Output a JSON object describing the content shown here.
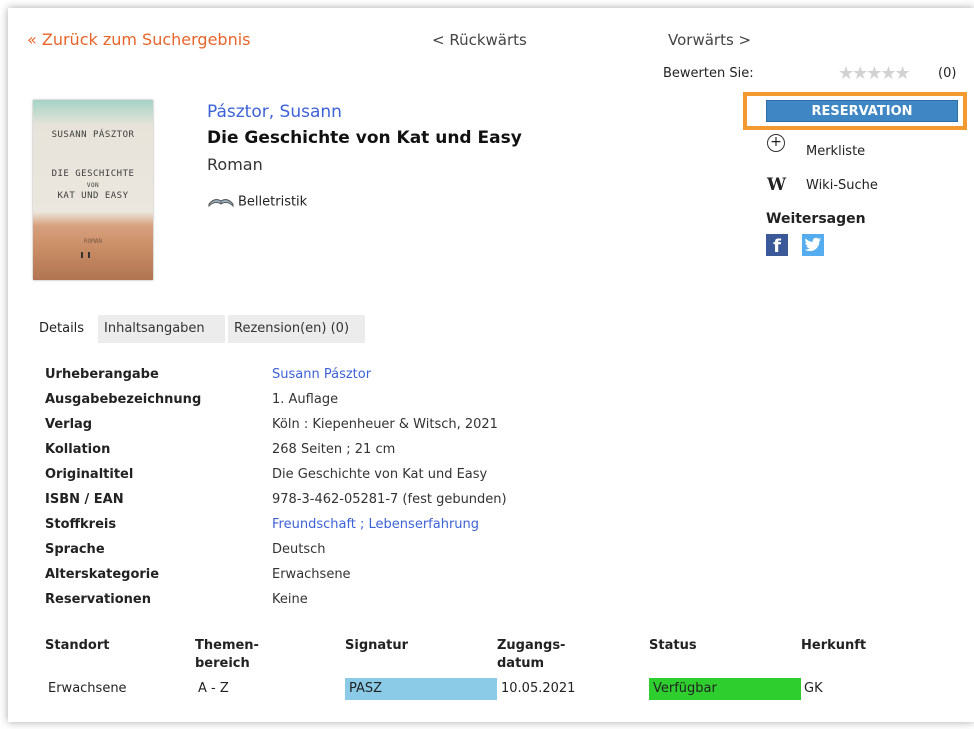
{
  "nav": {
    "back_label": "« Zurück zum Suchergebnis",
    "prev_label": "< Rückwärts",
    "next_label": "Vorwärts >"
  },
  "rating": {
    "label": "Bewerten Sie:",
    "stars": "★★★★★",
    "count": "(0)",
    "value": 0
  },
  "cover": {
    "author": "SUSANN PÁSZTOR",
    "title_line1": "DIE GESCHICHTE",
    "title_line2": "VON",
    "title_line3": "KAT UND EASY",
    "genre": "ROMAN"
  },
  "book": {
    "author": "Pásztor, Susann",
    "title": "Die Geschichte von Kat und Easy",
    "subtitle": "Roman",
    "genre": "Belletristik"
  },
  "actions": {
    "reserve_label": "RESERVATION",
    "merkliste_label": "Merkliste",
    "wiki_icon": "W",
    "wiki_label": "Wiki-Suche",
    "share_label": "Weitersagen",
    "facebook_icon": "f"
  },
  "tabs": [
    "Details",
    "Inhaltsangaben",
    "Rezension(en) (0)"
  ],
  "details": [
    {
      "label": "Urheberangabe",
      "value": "Susann Pásztor"
    },
    {
      "label": "Ausgabebezeichnung",
      "value": "1. Auflage"
    },
    {
      "label": "Verlag",
      "value": "Köln : Kiepenheuer & Witsch, 2021"
    },
    {
      "label": "Kollation",
      "value": "268 Seiten ; 21 cm"
    },
    {
      "label": "Originaltitel",
      "value": "Die Geschichte von Kat und Easy"
    },
    {
      "label": "ISBN / EAN",
      "value": "978-3-462-05281-7 (fest gebunden)"
    },
    {
      "label": "Stoffkreis",
      "value": "Freundschaft ; Lebenserfahrung",
      "link1": "Freundschaft",
      "sep": " ; ",
      "link2": "Lebenserfahrung"
    },
    {
      "label": "Sprache",
      "value": "Deutsch"
    },
    {
      "label": "Alterskategorie",
      "value": "Erwachsene"
    },
    {
      "label": "Reservationen",
      "value": "Keine"
    }
  ],
  "holdings": {
    "headers": {
      "standort": "Standort",
      "themen1": "Themen-",
      "themen2": "bereich",
      "signatur": "Signatur",
      "zugang1": "Zugangs-",
      "zugang2": "datum",
      "status": "Status",
      "herkunft": "Herkunft"
    },
    "row": {
      "standort": "Erwachsene",
      "themenbereich": "A - Z",
      "signatur": "PASZ",
      "zugangsdatum": "10.05.2021",
      "status": "Verfügbar",
      "herkunft": "GK"
    },
    "colors": {
      "signatur_bg": "#8bcbe7",
      "status_bg": "#2fce2f"
    }
  },
  "colors": {
    "accent": "#e8642a",
    "link": "#3d62d8",
    "button": "#3f87c4",
    "highlight": "#f29a2f"
  }
}
